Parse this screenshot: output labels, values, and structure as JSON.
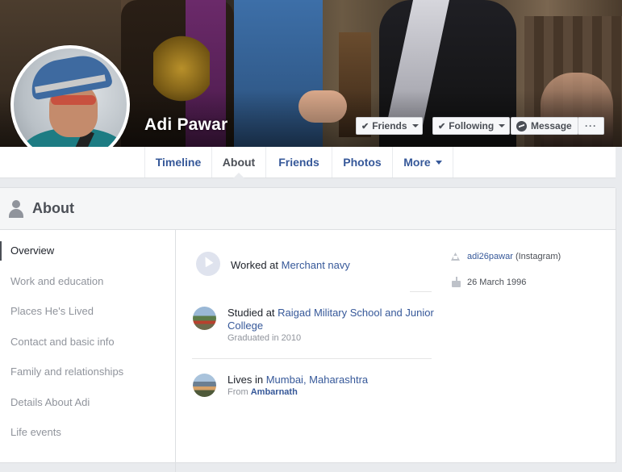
{
  "profile": {
    "name": "Adi Pawar"
  },
  "actions": {
    "friends": "Friends",
    "following": "Following",
    "message": "Message",
    "more": "···"
  },
  "tabs": [
    {
      "label": "Timeline"
    },
    {
      "label": "About"
    },
    {
      "label": "Friends"
    },
    {
      "label": "Photos"
    },
    {
      "label": "More"
    }
  ],
  "about": {
    "title": "About",
    "sidebar": [
      "Overview",
      "Work and education",
      "Places He's Lived",
      "Contact and basic info",
      "Family and relationships",
      "Details About Adi",
      "Life events"
    ],
    "work": {
      "prefix": "Worked at ",
      "place": "Merchant navy"
    },
    "education": {
      "prefix": "Studied at ",
      "school_line1": "Raigad Military School and Junior",
      "school_line2": "College",
      "detail": "Graduated in 2010"
    },
    "lives": {
      "prefix": "Lives in ",
      "city": "Mumbai, Maharashtra",
      "from_prefix": "From ",
      "from": "Ambarnath"
    },
    "contact": {
      "instagram_handle": "adi26pawar",
      "instagram_label": "(Instagram)",
      "birthday": "26 March 1996"
    }
  },
  "colors": {
    "link": "#365899",
    "muted": "#90949c",
    "background": "#e9ebee"
  }
}
